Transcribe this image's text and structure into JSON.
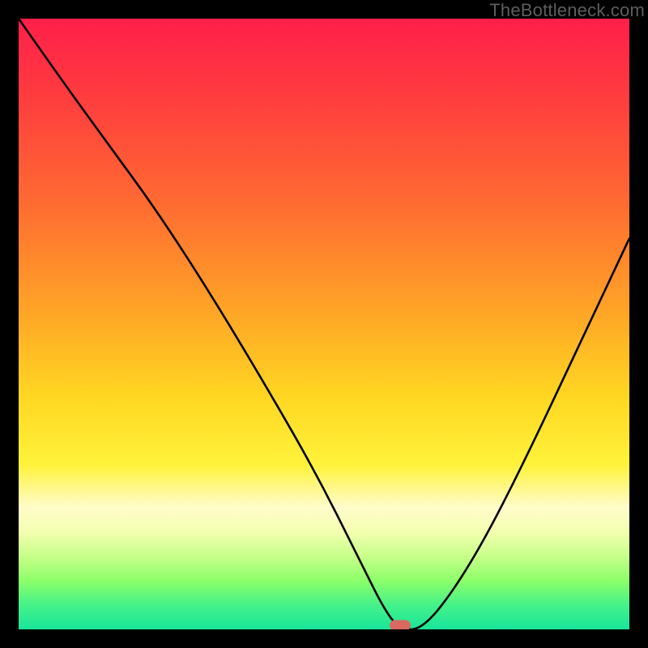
{
  "watermark": "TheBottleneck.com",
  "marker": {
    "x_frac": 0.625,
    "y_frac": 0.998,
    "color": "#d9695f"
  },
  "chart_data": {
    "type": "line",
    "title": "",
    "xlabel": "",
    "ylabel": "",
    "xlim": [
      0,
      1
    ],
    "ylim": [
      0,
      1
    ],
    "series": [
      {
        "name": "bottleneck-curve",
        "x": [
          0.0,
          0.07,
          0.15,
          0.23,
          0.32,
          0.41,
          0.49,
          0.56,
          0.6,
          0.625,
          0.66,
          0.71,
          0.77,
          0.84,
          0.92,
          1.0
        ],
        "y": [
          1.0,
          0.9,
          0.79,
          0.68,
          0.54,
          0.39,
          0.25,
          0.11,
          0.03,
          0.0,
          0.0,
          0.06,
          0.16,
          0.3,
          0.47,
          0.64
        ]
      }
    ],
    "annotations": [
      {
        "kind": "optimum-marker",
        "x": 0.625,
        "y": 0.0
      }
    ],
    "background_gradient": {
      "top_color": "#ff1f4a",
      "bottom_color": "#19e59a"
    }
  }
}
